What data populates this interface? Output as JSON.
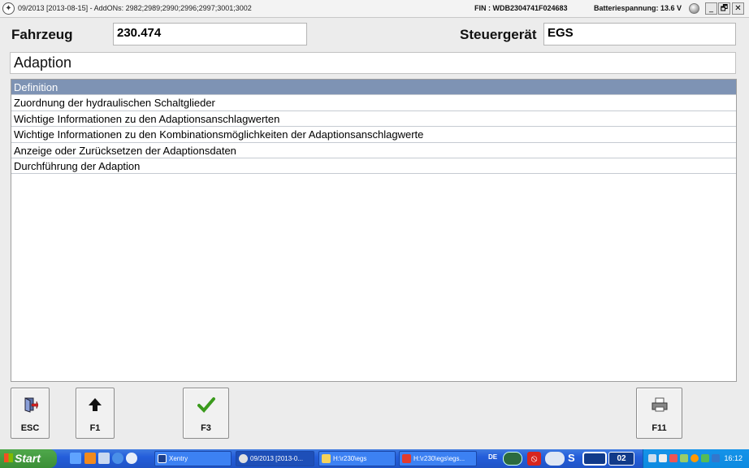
{
  "window": {
    "title": "09/2013 [2013-08-15] - AddONs: 2982;2989;2990;2996;2997;3001;3002",
    "fin": "FIN : WDB2304741F024683",
    "battery": "Batteriespannung: 13.6 V",
    "minimize": "_",
    "restore": "🗗",
    "close": "✕"
  },
  "header": {
    "vehicle_label": "Fahrzeug",
    "vehicle_value": "230.474",
    "ecu_label": "Steuergerät",
    "ecu_value": "EGS"
  },
  "section_title": "Adaption",
  "list": {
    "selected_index": 0,
    "items": [
      "Definition",
      "Zuordnung der hydraulischen Schaltglieder",
      "Wichtige Informationen zu den Adaptionsanschlagwerten",
      "Wichtige Informationen zu den Kombinationsmöglichkeiten der Adaptionsanschlagwerte",
      "Anzeige oder Zurücksetzen der Adaptionsdaten",
      "Durchführung der Adaption"
    ]
  },
  "function_keys": {
    "esc": {
      "label": "ESC",
      "icon": "exit-door-icon"
    },
    "f1": {
      "label": "F1",
      "icon": "arrow-up-icon"
    },
    "f3": {
      "label": "F3",
      "icon": "checkmark-icon"
    },
    "f11": {
      "label": "F11",
      "icon": "printer-icon"
    }
  },
  "taskbar": {
    "start_label": "Start",
    "tasks": [
      {
        "label": "Xentry",
        "icon": "xentry-icon"
      },
      {
        "label": "09/2013 [2013-0...",
        "icon": "mercedes-star-icon"
      },
      {
        "label": "H:\\r230\\egs",
        "icon": "folder-icon"
      },
      {
        "label": "H:\\r230\\egs\\egs...",
        "icon": "red-star-icon"
      }
    ],
    "language": "DE",
    "tray_badge": "02",
    "clock": "16:12"
  },
  "colors": {
    "selection": "#7e93b4",
    "taskbar": "#245edb",
    "start": "#3a8e36"
  }
}
